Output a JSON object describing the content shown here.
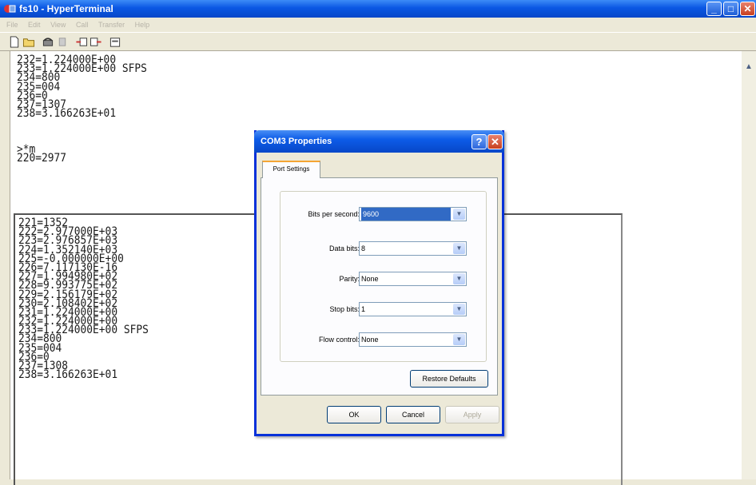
{
  "window": {
    "title": "fs10 - HyperTerminal",
    "menu": [
      "File",
      "Edit",
      "View",
      "Call",
      "Transfer",
      "Help"
    ],
    "controls": {
      "minimize": "_",
      "maximize": "□",
      "close": "✕"
    }
  },
  "toolbar": {
    "icons": [
      "new-icon",
      "open-icon",
      "call-icon",
      "disconnect-icon",
      "send-icon",
      "receive-icon",
      "properties-icon"
    ]
  },
  "terminal": {
    "upper_lines": [
      "232=1.224000E+00",
      "233=1.224000E+00 SFPS",
      "234=800",
      "235=004",
      "236=0",
      "237=1307",
      "238=3.166263E+01",
      "",
      "",
      "",
      ">*m",
      "220=2977"
    ],
    "lower_lines": [
      "221=1352",
      "222=2.977000E+03",
      "223=2.976857E+03",
      "224=1.352140E+03",
      "225=-0.000000E+00",
      "226=7.117130E-16",
      "227=1.994980E+02",
      "228=9.993775E+02",
      "229=2.156179E+02",
      "230=2.108402E+02",
      "231=1.224000E+00",
      "232=1.224000E+00",
      "233=1.224000E+00 SFPS",
      "234=800",
      "235=004",
      "236=0",
      "237=1308",
      "238=3.166263E+01"
    ]
  },
  "dialog": {
    "title": "COM3 Properties",
    "help": "?",
    "close": "✕",
    "tab": "Port Settings",
    "fields": [
      {
        "label": "Bits per second:",
        "value": "9600"
      },
      {
        "label": "Data bits:",
        "value": "8"
      },
      {
        "label": "Parity:",
        "value": "None"
      },
      {
        "label": "Stop bits:",
        "value": "1"
      },
      {
        "label": "Flow control:",
        "value": "None"
      }
    ],
    "restore_defaults": "Restore Defaults",
    "ok": "OK",
    "cancel": "Cancel",
    "apply": "Apply"
  }
}
